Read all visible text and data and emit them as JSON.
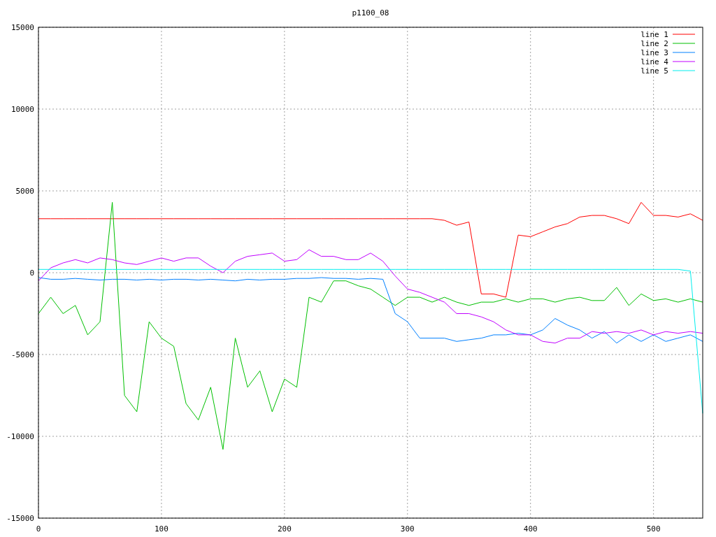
{
  "chart_data": {
    "type": "line",
    "title": "p1100_08",
    "x": [
      0,
      10,
      20,
      30,
      40,
      50,
      60,
      70,
      80,
      90,
      100,
      110,
      120,
      130,
      140,
      150,
      160,
      170,
      180,
      190,
      200,
      210,
      220,
      230,
      240,
      250,
      260,
      270,
      280,
      290,
      300,
      310,
      320,
      330,
      340,
      350,
      360,
      370,
      380,
      390,
      400,
      410,
      420,
      430,
      440,
      450,
      460,
      470,
      480,
      490,
      500,
      510,
      520,
      530,
      540
    ],
    "series": [
      {
        "name": "line 1",
        "color": "#ff0000",
        "values": [
          3300,
          3300,
          3300,
          3300,
          3300,
          3300,
          3300,
          3300,
          3300,
          3300,
          3300,
          3300,
          3300,
          3300,
          3300,
          3300,
          3300,
          3300,
          3300,
          3300,
          3300,
          3300,
          3300,
          3300,
          3300,
          3300,
          3300,
          3300,
          3300,
          3300,
          3300,
          3300,
          3300,
          3200,
          2900,
          3100,
          -1300,
          -1300,
          -1500,
          2300,
          2200,
          2500,
          2800,
          3000,
          3400,
          3500,
          3500,
          3300,
          3000,
          4300,
          3500,
          3500,
          3400,
          3600,
          3200
        ]
      },
      {
        "name": "line 2",
        "color": "#00c000",
        "values": [
          -2500,
          -1500,
          -2500,
          -2000,
          -3800,
          -3000,
          4300,
          -7500,
          -8500,
          -3000,
          -4000,
          -4500,
          -8000,
          -9000,
          -7000,
          -10800,
          -4000,
          -7000,
          -6000,
          -8500,
          -6500,
          -7000,
          -1500,
          -1800,
          -500,
          -500,
          -800,
          -1000,
          -1500,
          -2000,
          -1500,
          -1500,
          -1800,
          -1500,
          -1800,
          -2000,
          -1800,
          -1800,
          -1600,
          -1800,
          -1600,
          -1600,
          -1800,
          -1600,
          -1500,
          -1700,
          -1700,
          -900,
          -2000,
          -1300,
          -1700,
          -1600,
          -1800,
          -1600,
          -1800
        ]
      },
      {
        "name": "line 3",
        "color": "#0080ff",
        "values": [
          -300,
          -400,
          -400,
          -350,
          -400,
          -450,
          -400,
          -400,
          -450,
          -400,
          -450,
          -400,
          -400,
          -450,
          -400,
          -450,
          -500,
          -400,
          -450,
          -400,
          -400,
          -350,
          -350,
          -300,
          -350,
          -350,
          -400,
          -350,
          -400,
          -2500,
          -3000,
          -4000,
          -4000,
          -4000,
          -4200,
          -4100,
          -4000,
          -3800,
          -3800,
          -3700,
          -3800,
          -3500,
          -2800,
          -3200,
          -3500,
          -4000,
          -3600,
          -4300,
          -3800,
          -4200,
          -3800,
          -4200,
          -4000,
          -3800,
          -4200
        ]
      },
      {
        "name": "line 4",
        "color": "#c000ff",
        "values": [
          -500,
          300,
          600,
          800,
          600,
          900,
          800,
          600,
          500,
          700,
          900,
          700,
          900,
          900,
          400,
          0,
          700,
          1000,
          1100,
          1200,
          700,
          800,
          1400,
          1000,
          1000,
          800,
          800,
          1200,
          700,
          -200,
          -1000,
          -1200,
          -1500,
          -1800,
          -2500,
          -2500,
          -2700,
          -3000,
          -3500,
          -3800,
          -3800,
          -4200,
          -4300,
          -4000,
          -4000,
          -3600,
          -3700,
          -3600,
          -3700,
          -3500,
          -3800,
          -3600,
          -3700,
          -3600,
          -3700
        ]
      },
      {
        "name": "line 5",
        "color": "#00eeee",
        "values": [
          200,
          200,
          200,
          200,
          200,
          200,
          200,
          200,
          200,
          200,
          200,
          200,
          200,
          200,
          200,
          200,
          200,
          200,
          200,
          200,
          200,
          200,
          200,
          200,
          200,
          200,
          200,
          200,
          200,
          200,
          200,
          200,
          200,
          200,
          200,
          200,
          200,
          200,
          200,
          200,
          200,
          200,
          200,
          200,
          200,
          200,
          200,
          200,
          200,
          200,
          200,
          200,
          200,
          100,
          -8600
        ]
      }
    ],
    "xlim": [
      0,
      540
    ],
    "ylim": [
      -15000,
      15000
    ],
    "xticks": [
      0,
      100,
      200,
      300,
      400,
      500
    ],
    "yticks": [
      -15000,
      -10000,
      -5000,
      0,
      5000,
      10000,
      15000
    ],
    "grid": true,
    "legend": true
  }
}
